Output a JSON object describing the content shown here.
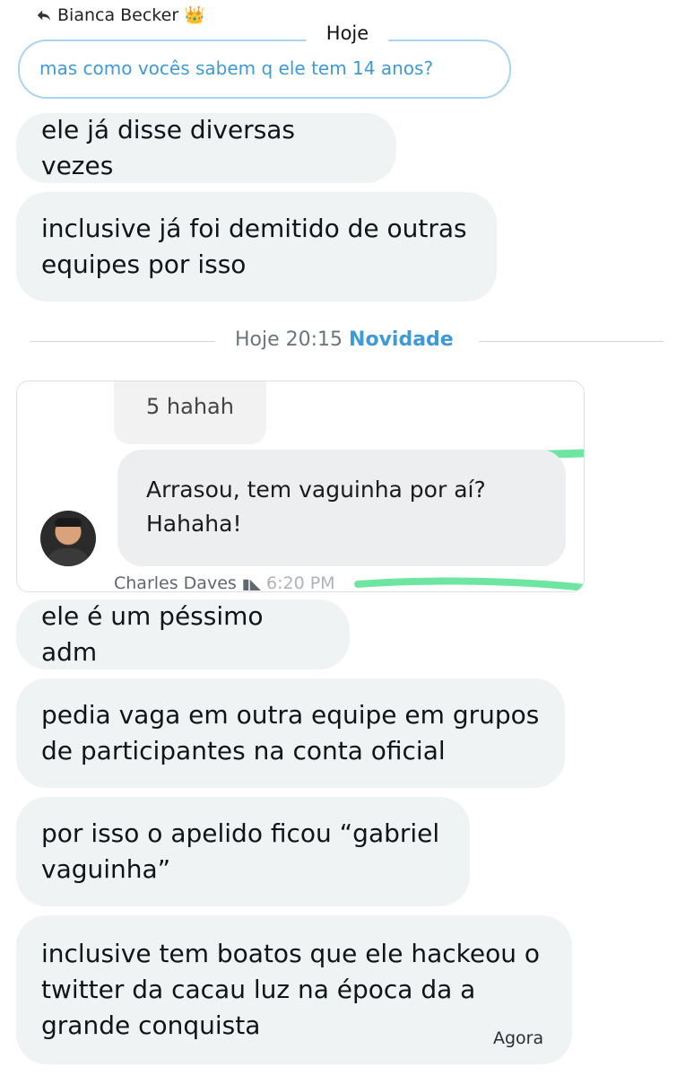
{
  "reply_header": {
    "name": "Bianca Becker",
    "crown": "👑",
    "reply_icon": "reply-arrow-icon"
  },
  "quoted_message": {
    "text": "mas como vocês sabem q ele tem 14 anos?"
  },
  "date_pill": {
    "label": "Hoje"
  },
  "messages_before": [
    {
      "text": "ele já disse diversas vezes"
    },
    {
      "text": "inclusive já foi demitido de outras\nequipes por isso"
    }
  ],
  "divider": {
    "time": "Hoje 20:15",
    "new_label": "Novidade"
  },
  "embedded_image": {
    "top_bubble": "5 hahah",
    "main_bubble": "Arrasou, tem vaguinha por aí?\nHahaha!",
    "sender_name": "Charles Daves",
    "sender_time": "6:20 PM"
  },
  "messages_after": [
    {
      "text": "ele é um péssimo adm"
    },
    {
      "text": "pedia vaga em outra equipe em grupos\nde participantes na conta oficial"
    },
    {
      "text": "por isso o apelido ficou “gabriel\nvaguinha”"
    },
    {
      "text": "inclusive tem boatos que ele hackeou o\ntwitter da cacau luz na época da a\ngrande conquista"
    }
  ],
  "last_timestamp": "Agora",
  "colors": {
    "bubble": "#eff3f4",
    "accent": "#3e9ad6",
    "highlight": "#6ee6a2"
  }
}
